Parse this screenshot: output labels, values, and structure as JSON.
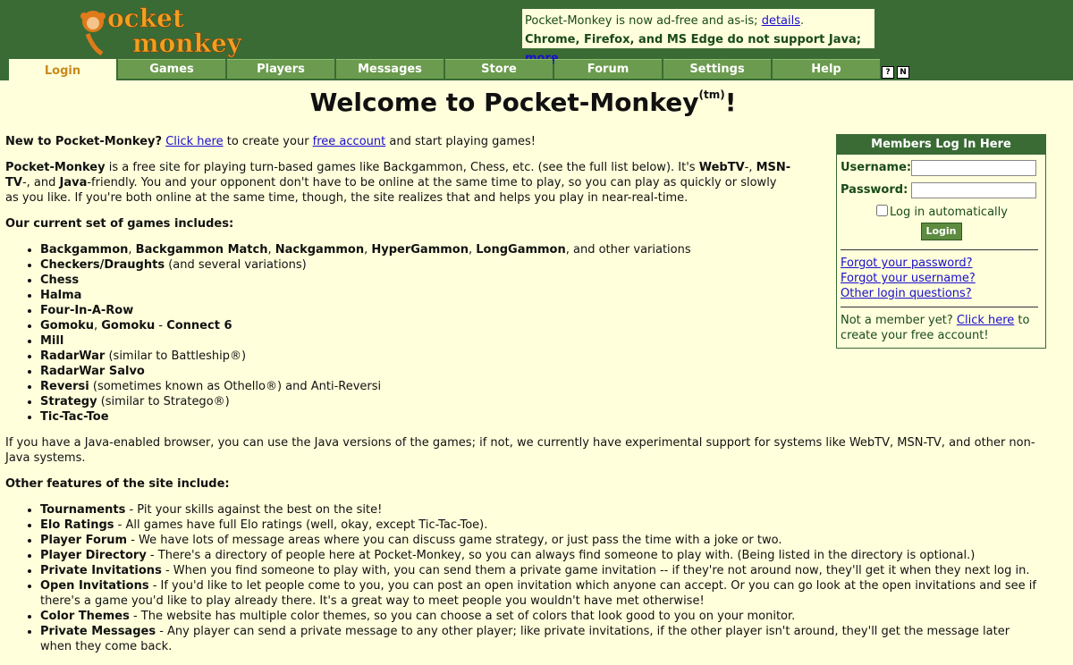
{
  "notice": {
    "line1_text": "Pocket-Monkey is now ad-free and as-is; ",
    "line1_link": "details",
    "line1_end": ".",
    "line2_text": "Chrome, Firefox, and MS Edge do not support Java; ",
    "line2_link": "more",
    "line2_end": "."
  },
  "tabs": [
    {
      "label": "Login"
    },
    {
      "label": "Games"
    },
    {
      "label": "Players"
    },
    {
      "label": "Messages"
    },
    {
      "label": "Store"
    },
    {
      "label": "Forum"
    },
    {
      "label": "Settings"
    },
    {
      "label": "Help"
    }
  ],
  "mini_icons": [
    "?",
    "N"
  ],
  "title": {
    "main": "Welcome to Pocket-Monkey",
    "sup": "(tm)",
    "end": "!"
  },
  "intro": {
    "new_label": "New to Pocket-Monkey?",
    "click_here": "Click here",
    "to_create": " to create your ",
    "free_account": "free account",
    "and_start": " and start playing games!"
  },
  "about": {
    "p1_name": "Pocket-Monkey",
    "p1_a": " is a free site for playing turn-based games like Backgammon, Chess, etc. (see the full list below). It's ",
    "webtv": "WebTV",
    "dash1": "-, ",
    "msntv": "MSN-TV",
    "dash2": "-, and ",
    "java": "Java",
    "p1_b": "-friendly. You and your opponent don't have to be online at the same time to play, so you can play as quickly or slowly as you like. If you're both online at the same time, though, the site realizes that and helps you play in near-real-time."
  },
  "games_heading": "Our current set of games includes:",
  "games": [
    {
      "b": "Backgammon",
      "t": ", "
    },
    {
      "b": "Checkers/Draughts",
      "t": " (and several variations)"
    },
    {
      "b": "Chess",
      "t": ""
    },
    {
      "b": "Halma",
      "t": ""
    },
    {
      "b": "Four-In-A-Row",
      "t": ""
    },
    {
      "b": "Gomoku",
      "t": ", "
    },
    {
      "b": "Mill",
      "t": ""
    },
    {
      "b": "RadarWar",
      "t": " (similar to Battleship®)"
    },
    {
      "b": "RadarWar Salvo",
      "t": ""
    },
    {
      "b": "Reversi",
      "t": " (sometimes known as Othello®) and Anti-Reversi"
    },
    {
      "b": "Strategy",
      "t": " (similar to Stratego®)"
    },
    {
      "b": "Tic-Tac-Toe",
      "t": ""
    }
  ],
  "games_extra": {
    "bg_match": "Backgammon Match",
    "nack": "Nackgammon",
    "hyper": "HyperGammon",
    "long": "LongGammon",
    "bg_tail": ", and other variations",
    "gomoku2": "Gomoku",
    "connect6": "Connect 6",
    "sep_comma": ", ",
    "sep_dash": " - "
  },
  "java_note": "If you have a Java-enabled browser, you can use the Java versions of the games; if not, we currently have experimental support for systems like WebTV, MSN-TV, and other non-Java systems.",
  "features_heading": "Other features of the site include:",
  "features": [
    {
      "b": "Tournaments",
      "t": " - Pit your skills against the best on the site!"
    },
    {
      "b": "Elo Ratings",
      "t": " - All games have full Elo ratings (well, okay, except Tic-Tac-Toe)."
    },
    {
      "b": "Player Forum",
      "t": " - We have lots of message areas where you can discuss game strategy, or just pass the time with a joke or two."
    },
    {
      "b": "Player Directory",
      "t": " - There's a directory of people here at Pocket-Monkey, so you can always find someone to play with. (Being listed in the directory is optional.)"
    },
    {
      "b": "Private Invitations",
      "t": " - When you find someone to play with, you can send them a private game invitation -- if they're not around now, they'll get it when they next log in."
    },
    {
      "b": "Open Invitations",
      "t": " - If you'd like to let people come to you, you can post an open invitation which anyone can accept. Or you can go look at the open invitations and see if there's a game you'd like to play already there. It's a great way to meet people you wouldn't have met otherwise!"
    },
    {
      "b": "Color Themes",
      "t": " - The website has multiple color themes, so you can choose a set of colors that look good to you on your monitor."
    },
    {
      "b": "Private Messages",
      "t": " - Any player can send a private message to any other player; like private invitations, if the other player isn't around, they'll get the message later when they come back."
    }
  ],
  "login": {
    "title": "Members Log In Here",
    "username_label": "Username:",
    "password_label": "Password:",
    "auto_label": "Log in automatically",
    "button": "Login",
    "forgot_password": "Forgot your password?",
    "forgot_username": "Forgot your username?",
    "other_questions": "Other login questions?",
    "not_member": "Not a member yet? ",
    "click_here": "Click here",
    "to_create": " to create your free account!"
  },
  "colors": {
    "header_green": "#3a6b35",
    "tab_green": "#6b9b4e",
    "page_bg": "#ffffdc",
    "tab_active_text": "#c88a1a"
  }
}
